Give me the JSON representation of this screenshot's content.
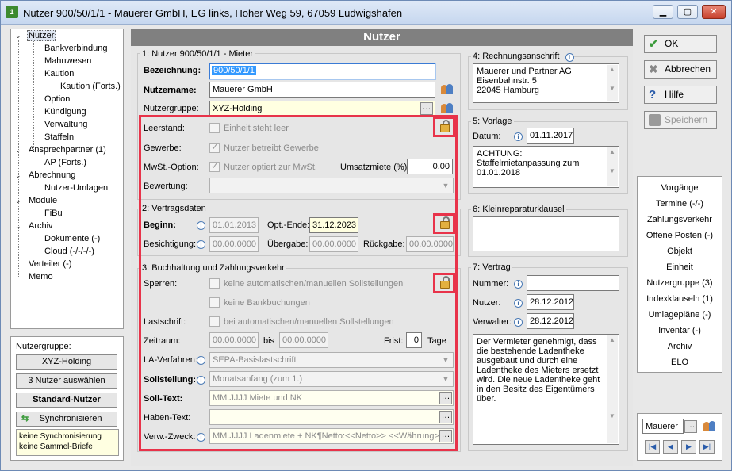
{
  "window": {
    "title": "Nutzer 900/50/1/1 - Mauerer GmbH, EG links, Hoher Weg 59, 67059 Ludwigshafen",
    "app_icon_text": "1"
  },
  "tree": {
    "items": [
      "Nutzer",
      "Bankverbindung",
      "Mahnwesen",
      "Kaution",
      "Kaution (Forts.)",
      "Option",
      "Kündigung",
      "Verwaltung",
      "Staffeln",
      "Ansprechpartner (1)",
      "AP (Forts.)",
      "Abrechnung",
      "Nutzer-Umlagen",
      "Module",
      "FiBu",
      "Archiv",
      "Dokumente (-)",
      "Cloud (-/-/-/-)",
      "Verteiler (-)",
      "Memo"
    ]
  },
  "left_panel": {
    "title": "Nutzergruppe:",
    "group_button": "XYZ-Holding",
    "select_button": "3 Nutzer auswählen",
    "standard_button": "Standard-Nutzer",
    "sync_button": "Synchronisieren",
    "note": "keine Synchronisierung keine Sammel-Briefe"
  },
  "header": "Nutzer",
  "section1": {
    "title": "1: Nutzer 900/50/1/1 - Mieter",
    "bezeichnung_label": "Bezeichnung:",
    "bezeichnung_value": "900/50/1/1",
    "nutzername_label": "Nutzername:",
    "nutzername_value": "Mauerer GmbH",
    "nutzergruppe_label": "Nutzergruppe:",
    "nutzergruppe_value": "XYZ-Holding",
    "leerstand_label": "Leerstand:",
    "leerstand_check": "Einheit steht leer",
    "gewerbe_label": "Gewerbe:",
    "gewerbe_check": "Nutzer betreibt Gewerbe",
    "mwst_label": "MwSt.-Option:",
    "mwst_check": "Nutzer optiert zur MwSt.",
    "umsatzmiete_label": "Umsatzmiete (%):",
    "umsatzmiete_value": "0,00",
    "bewertung_label": "Bewertung:",
    "bewertung_value": ""
  },
  "section2": {
    "title": "2: Vertragsdaten",
    "beginn_label": "Beginn:",
    "beginn_value": "01.01.2013",
    "optende_label": "Opt.-Ende:",
    "optende_value": "31.12.2023",
    "besichtigung_label": "Besichtigung:",
    "besichtigung_value": "00.00.0000",
    "uebergabe_label": "Übergabe:",
    "uebergabe_value": "00.00.0000",
    "rueckgabe_label": "Rückgabe:",
    "rueckgabe_value": "00.00.0000"
  },
  "section3": {
    "title": "3: Buchhaltung und Zahlungsverkehr",
    "sperren_label": "Sperren:",
    "sperren_check1": "keine automatischen/manuellen Sollstellungen",
    "sperren_check2": "keine Bankbuchungen",
    "lastschrift_label": "Lastschrift:",
    "lastschrift_check": "bei automatischen/manuellen Sollstellungen",
    "zeitraum_label": "Zeitraum:",
    "zeitraum_from": "00.00.0000",
    "zeitraum_bis": "bis",
    "zeitraum_to": "00.00.0000",
    "frist_label": "Frist:",
    "frist_value": "0",
    "tage_label": "Tage",
    "la_label": "LA-Verfahren:",
    "la_value": "SEPA-Basislastschrift",
    "soll_stellung_label": "Sollstellung:",
    "soll_stellung_value": "Monatsanfang (zum 1.)",
    "soll_text_label": "Soll-Text:",
    "soll_text_value": "MM.JJJJ Miete und NK",
    "haben_text_label": "Haben-Text:",
    "haben_text_value": "",
    "verw_label": "Verw.-Zweck:",
    "verw_value": "MM.JJJJ Ladenmiete + NK¶Netto:<<Netto>> <<Währung>>"
  },
  "section4": {
    "title": "4: Rechnungsanschrift",
    "address": [
      "Mauerer und Partner AG",
      "Eisenbahnstr. 5",
      "22045 Hamburg"
    ]
  },
  "section5": {
    "title": "5: Vorlage",
    "datum_label": "Datum:",
    "datum_value": "01.11.2017",
    "text": [
      "ACHTUNG:",
      "Staffelmietanpassung zum",
      "01.01.2018"
    ]
  },
  "section6": {
    "title": "6: Kleinreparaturklausel",
    "text": ""
  },
  "section7": {
    "title": "7: Vertrag",
    "nummer_label": "Nummer:",
    "nummer_value": "",
    "nutzer_label": "Nutzer:",
    "nutzer_value": "28.12.2012",
    "verwalter_label": "Verwalter:",
    "verwalter_value": "28.12.2012",
    "text": "Der Vermieter genehmigt, dass die bestehende Ladentheke ausgebaut und durch eine Ladentheke des Mieters ersetzt wird. Die neue Ladentheke geht in den Besitz des Eigentümers über."
  },
  "buttons": {
    "ok": "OK",
    "abbrechen": "Abbrechen",
    "hilfe": "Hilfe",
    "speichern": "Speichern"
  },
  "right_list": [
    "Vorgänge",
    "Termine (-/-)",
    "Zahlungsverkehr",
    "Offene Posten (-)",
    "Objekt",
    "Einheit",
    "Nutzergruppe (3)",
    "Indexklauseln (1)",
    "Umlagepläne (-)",
    "Inventar (-)",
    "Archiv",
    "ELO"
  ],
  "search": {
    "value": "Mauerer"
  },
  "colors": {
    "highlight": "#e8334a",
    "header": "#808080",
    "note_bg": "#ffffe1"
  }
}
